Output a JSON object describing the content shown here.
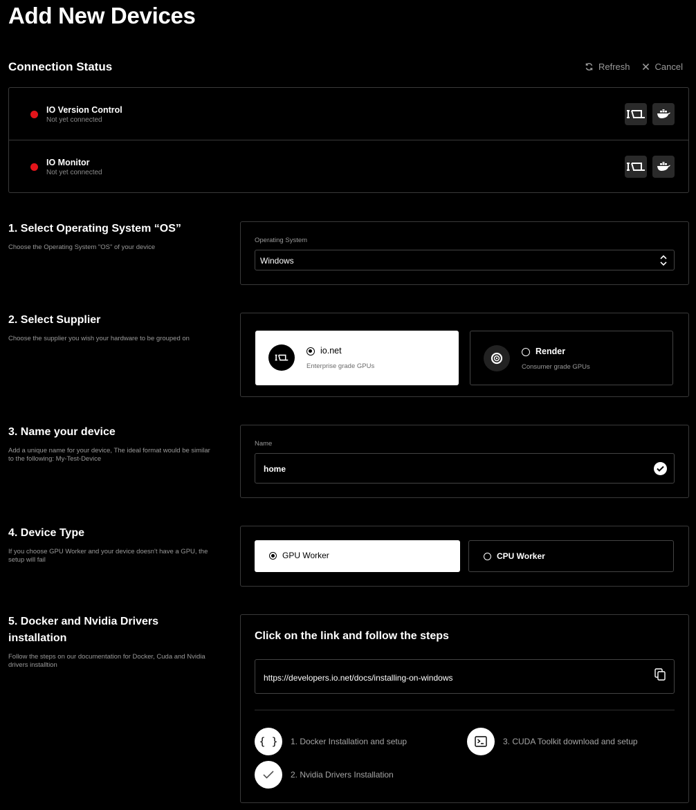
{
  "page": {
    "title": "Add New Devices"
  },
  "connection": {
    "title": "Connection Status",
    "refresh_label": "Refresh",
    "cancel_label": "Cancel",
    "rows": [
      {
        "name": "IO Version Control",
        "status": "Not yet connected",
        "status_color": "#e3141a",
        "icons": [
          "io-net-icon",
          "docker-icon"
        ]
      },
      {
        "name": "IO Monitor",
        "status": "Not yet connected",
        "status_color": "#e3141a",
        "icons": [
          "io-net-icon",
          "docker-icon"
        ]
      }
    ]
  },
  "os": {
    "title": "1. Select Operating System “OS”",
    "description": "Choose the Operating System \"OS\" of your device",
    "field_label": "Operating System",
    "selected": "Windows"
  },
  "supplier": {
    "title": "2. Select Supplier",
    "description": "Choose the supplier you wish your hardware to be grouped on",
    "options": [
      {
        "name": "io.net",
        "subtitle": "Enterprise grade GPUs",
        "selected": true,
        "icon": "io-net-icon"
      },
      {
        "name": "Render",
        "subtitle": "Consumer grade GPUs",
        "selected": false,
        "icon": "render-icon"
      }
    ]
  },
  "name": {
    "title": "3. Name your device",
    "description": "Add a unique name for your device, The ideal format would be similar to the following: My-Test-Device",
    "field_label": "Name",
    "value": "home"
  },
  "device_type": {
    "title": "4. Device Type",
    "description": "If you choose GPU Worker and your device doesn't have a GPU, the setup will fail",
    "options": [
      {
        "label": "GPU Worker",
        "selected": true
      },
      {
        "label": "CPU Worker",
        "selected": false
      }
    ]
  },
  "docker": {
    "title": "5. Docker and Nvidia Drivers installation",
    "description": "Follow the steps on our documentation for Docker, Cuda and Nvidia drivers installtion",
    "heading": "Click on the link and follow the steps",
    "link": "https://developers.io.net/docs/installing-on-windows",
    "steps": [
      {
        "label": "1. Docker Installation and setup",
        "icon": "braces-icon",
        "glyph": "{ }"
      },
      {
        "label": "2. Nvidia Drivers Installation",
        "icon": "check-icon",
        "glyph": "✓"
      },
      {
        "label": "3. CUDA Toolkit download and setup",
        "icon": "terminal-icon",
        "glyph": ">_"
      }
    ]
  }
}
